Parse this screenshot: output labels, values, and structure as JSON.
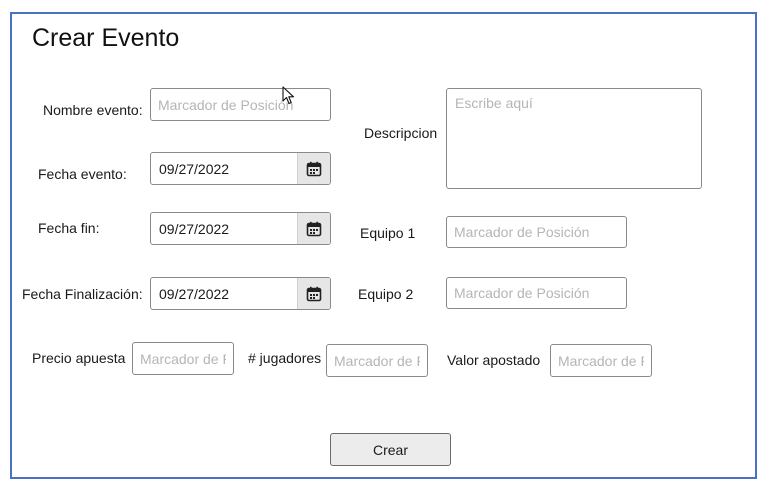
{
  "form": {
    "title": "Crear Evento",
    "nombre_label": "Nombre evento:",
    "nombre_placeholder": "Marcador de Posición",
    "descripcion_label": "Descripcion",
    "descripcion_placeholder": "Escribe aquí",
    "fecha_evento_label": "Fecha evento:",
    "fecha_evento_value": "09/27/2022",
    "fecha_fin_label": "Fecha fin:",
    "fecha_fin_value": "09/27/2022",
    "fecha_finalizacion_label": "Fecha Finalización:",
    "fecha_finalizacion_value": "09/27/2022",
    "equipo1_label": "Equipo 1",
    "equipo1_placeholder": "Marcador de Posición",
    "equipo2_label": "Equipo 2",
    "equipo2_placeholder": "Marcador de Posición",
    "precio_label": "Precio apuesta",
    "precio_placeholder": "Marcador de Posición",
    "jugadores_label": "# jugadores",
    "jugadores_placeholder": "Marcador de Posición",
    "valor_label": "Valor apostado",
    "valor_placeholder": "Marcador de Posición",
    "submit_label": "Crear"
  },
  "icons": {
    "calendar": "calendar-icon",
    "cursor": "mouse-pointer-icon"
  },
  "colors": {
    "frame_border": "#4a72c4",
    "placeholder": "#b5b5b5",
    "calendar_bg": "#e6e6e6",
    "button_bg": "#ececec"
  }
}
